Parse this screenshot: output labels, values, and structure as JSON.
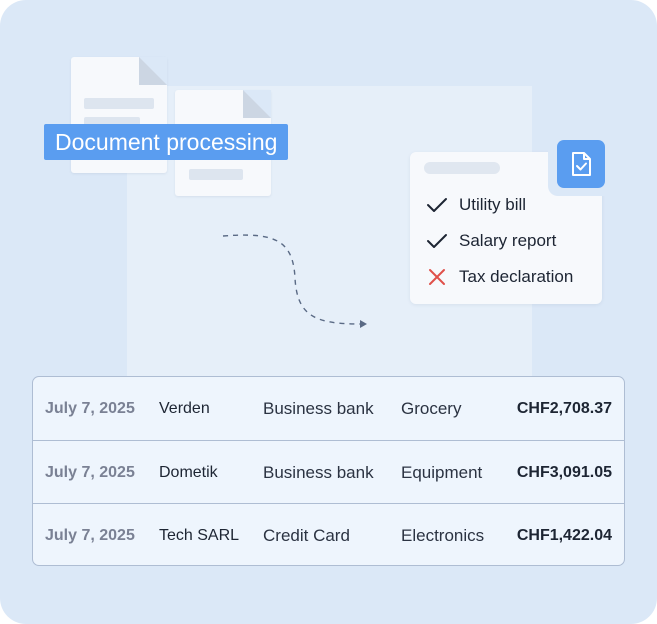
{
  "header": {
    "title": "Document processing"
  },
  "checklist": {
    "items": [
      {
        "label": "Utility bill",
        "status": "ok",
        "icon": "check-icon"
      },
      {
        "label": "Salary report",
        "status": "ok",
        "icon": "check-icon"
      },
      {
        "label": "Tax declaration",
        "status": "missing",
        "icon": "cross-icon"
      }
    ],
    "badge_icon": "document-check-icon"
  },
  "transactions": {
    "rows": [
      {
        "date": "July 7, 2025",
        "merchant": "Verden",
        "account": "Business bank",
        "category": "Grocery",
        "amount": "CHF2,708.37"
      },
      {
        "date": "July 7, 2025",
        "merchant": "Dometik",
        "account": "Business bank",
        "category": "Equipment",
        "amount": "CHF3,091.05"
      },
      {
        "date": "July 7, 2025",
        "merchant": "Tech SARL",
        "account": "Credit Card",
        "category": "Electronics",
        "amount": "CHF1,422.04"
      }
    ]
  },
  "colors": {
    "accent": "#5a9df0",
    "background": "#dbe8f7",
    "cross": "#e0504a",
    "text": "#1d2533"
  }
}
